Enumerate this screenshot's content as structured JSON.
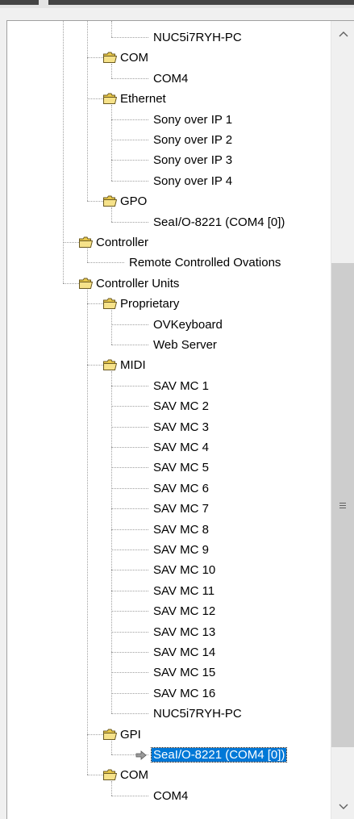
{
  "tree": {
    "rows": [
      {
        "label": "NUC5i7RYH-PC",
        "kind": "leaf",
        "level": 3
      },
      {
        "label": "COM",
        "kind": "folder",
        "level": 2
      },
      {
        "label": "COM4",
        "kind": "leaf",
        "level": 3
      },
      {
        "label": "Ethernet",
        "kind": "folder",
        "level": 2
      },
      {
        "label": "Sony over IP 1",
        "kind": "leaf",
        "level": 3
      },
      {
        "label": "Sony over IP 2",
        "kind": "leaf",
        "level": 3
      },
      {
        "label": "Sony over IP 3",
        "kind": "leaf",
        "level": 3
      },
      {
        "label": "Sony over IP 4",
        "kind": "leaf",
        "level": 3
      },
      {
        "label": "GPO",
        "kind": "folder",
        "level": 2
      },
      {
        "label": "SeaI/O-8221 (COM4 [0])",
        "kind": "leaf",
        "level": 3
      },
      {
        "label": "Controller",
        "kind": "folder",
        "level": 1
      },
      {
        "label": "Remote Controlled Ovations",
        "kind": "leaf",
        "level": 2
      },
      {
        "label": "Controller Units",
        "kind": "folder",
        "level": 1
      },
      {
        "label": "Proprietary",
        "kind": "folder",
        "level": 2
      },
      {
        "label": "OVKeyboard",
        "kind": "leaf",
        "level": 3
      },
      {
        "label": "Web Server",
        "kind": "leaf",
        "level": 3
      },
      {
        "label": "MIDI",
        "kind": "folder",
        "level": 2
      },
      {
        "label": "SAV MC 1",
        "kind": "leaf",
        "level": 3
      },
      {
        "label": "SAV MC 2",
        "kind": "leaf",
        "level": 3
      },
      {
        "label": "SAV MC 3",
        "kind": "leaf",
        "level": 3
      },
      {
        "label": "SAV MC 4",
        "kind": "leaf",
        "level": 3
      },
      {
        "label": "SAV MC 5",
        "kind": "leaf",
        "level": 3
      },
      {
        "label": "SAV MC 6",
        "kind": "leaf",
        "level": 3
      },
      {
        "label": "SAV MC 7",
        "kind": "leaf",
        "level": 3
      },
      {
        "label": "SAV MC 8",
        "kind": "leaf",
        "level": 3
      },
      {
        "label": "SAV MC 9",
        "kind": "leaf",
        "level": 3
      },
      {
        "label": "SAV MC 10",
        "kind": "leaf",
        "level": 3
      },
      {
        "label": "SAV MC 11",
        "kind": "leaf",
        "level": 3
      },
      {
        "label": "SAV MC 12",
        "kind": "leaf",
        "level": 3
      },
      {
        "label": "SAV MC 13",
        "kind": "leaf",
        "level": 3
      },
      {
        "label": "SAV MC 14",
        "kind": "leaf",
        "level": 3
      },
      {
        "label": "SAV MC 15",
        "kind": "leaf",
        "level": 3
      },
      {
        "label": "SAV MC 16",
        "kind": "leaf",
        "level": 3
      },
      {
        "label": "NUC5i7RYH-PC",
        "kind": "leaf",
        "level": 3
      },
      {
        "label": "GPI",
        "kind": "folder",
        "level": 2
      },
      {
        "label": "SeaI/O-8221 (COM4 [0])",
        "kind": "leaf",
        "level": 3,
        "selected": true,
        "icon": "arrow-icon"
      },
      {
        "label": "COM",
        "kind": "folder",
        "level": 2
      },
      {
        "label": "COM4",
        "kind": "leaf",
        "level": 3
      }
    ]
  },
  "scrollbar": {
    "up_icon": "chevron-up-icon",
    "down_icon": "chevron-down-icon",
    "grip_icon": "grip-icon",
    "position": 0.82
  },
  "colors": {
    "selection": "#0078d7",
    "folder": "#e8c84a",
    "thumb": "#cdcdcd"
  }
}
